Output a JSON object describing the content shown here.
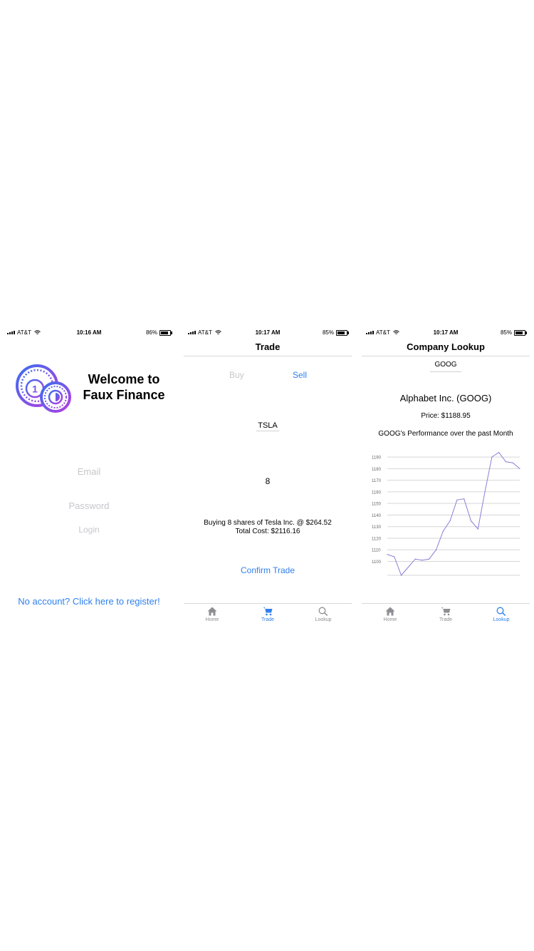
{
  "login_screen": {
    "status": {
      "carrier": "AT&T",
      "time": "10:16 AM",
      "battery": "86%",
      "battery_level": 0.86
    },
    "welcome_line1": "Welcome to",
    "welcome_line2": "Faux Finance",
    "email_placeholder": "Email",
    "password_placeholder": "Password",
    "login_label": "Login",
    "register_link": "No account? Click here to register!"
  },
  "trade_screen": {
    "status": {
      "carrier": "AT&T",
      "time": "10:17 AM",
      "battery": "85%",
      "battery_level": 0.85
    },
    "title": "Trade",
    "segment_buy": "Buy",
    "segment_sell": "Sell",
    "ticker": "TSLA",
    "quantity": "8",
    "summary_line1": "Buying 8 shares of Tesla Inc. @ $264.52",
    "summary_line2": "Total Cost: $2116.16",
    "confirm_label": "Confirm Trade",
    "tabs": [
      {
        "label": "Home",
        "icon": "home-icon"
      },
      {
        "label": "Trade",
        "icon": "cart-icon",
        "active": true
      },
      {
        "label": "Lookup",
        "icon": "search-icon"
      }
    ]
  },
  "lookup_screen": {
    "status": {
      "carrier": "AT&T",
      "time": "10:17 AM",
      "battery": "85%",
      "battery_level": 0.85
    },
    "title": "Company Lookup",
    "search_value": "GOOG",
    "company": "Alphabet Inc. (GOOG)",
    "price": "Price: $1188.95",
    "performance_title": "GOOG's Performance over the past Month",
    "tabs": [
      {
        "label": "Home",
        "icon": "home-icon"
      },
      {
        "label": "Trade",
        "icon": "cart-icon"
      },
      {
        "label": "Lookup",
        "icon": "search-icon",
        "active": true
      }
    ]
  },
  "colors": {
    "accent": "#2f80ed",
    "placeholder": "#c7c7cc",
    "line": "#8a7fd6",
    "grid": "#d6d6d6",
    "logo_start": "#3b6ff0",
    "logo_end": "#b53de0"
  },
  "chart_data": {
    "type": "line",
    "title": "GOOG's Performance over the past Month",
    "xlabel": "",
    "ylabel": "",
    "yticks": [
      1100,
      1110,
      1120,
      1130,
      1140,
      1150,
      1160,
      1170,
      1180,
      1190
    ],
    "ylim": [
      1088,
      1195
    ],
    "x": [
      0,
      1,
      2,
      3,
      4,
      5,
      6,
      7,
      8,
      9,
      10,
      11,
      12,
      13,
      14,
      15,
      16,
      17,
      18,
      19
    ],
    "values": [
      1106,
      1104,
      1088,
      1095,
      1102,
      1101,
      1102,
      1110,
      1126,
      1135,
      1153,
      1154,
      1135,
      1128,
      1160,
      1190,
      1194,
      1186,
      1185,
      1180
    ],
    "grid": true,
    "legend": "none"
  }
}
